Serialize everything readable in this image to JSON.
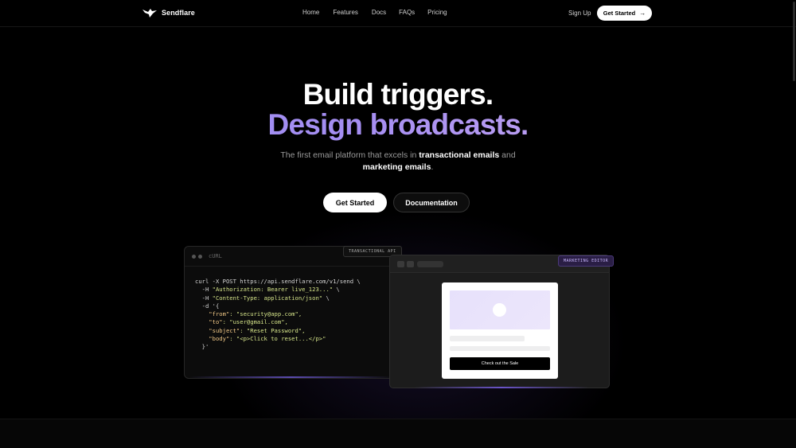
{
  "nav": {
    "brand": "Sendflare",
    "links": [
      "Home",
      "Features",
      "Docs",
      "FAQs",
      "Pricing"
    ],
    "signup": "Sign Up",
    "cta": "Get Started",
    "cta_icon": "arrow-right-icon"
  },
  "hero": {
    "line1": "Build triggers.",
    "line2": "Design broadcasts.",
    "sub_prefix": "The first email platform that excels in ",
    "sub_bold1": "transactional emails",
    "sub_mid": " and",
    "sub_bold2": "marketing emails",
    "sub_suffix": ".",
    "primary_button": "Get Started",
    "secondary_button": "Documentation",
    "gradient_colors": [
      "#9a8ff0",
      "#d6b3f2"
    ]
  },
  "code_panel": {
    "title": "cURL",
    "tag": "TRANSACTIONAL API",
    "lines": {
      "l1": "curl -X POST https://api.sendflare.com/v1/send \\",
      "l2a": "  -H ",
      "l2b": "\"Authorization: Bearer live_123...\"",
      "l2c": " \\",
      "l3a": "  -H ",
      "l3b": "\"Content-Type: application/json\"",
      "l3c": " \\",
      "l4": "  -d '{",
      "l5k": "    \"from\"",
      "l5v": ": \"security@app.com\",",
      "l6k": "    \"to\"",
      "l6v": ": \"user@gmail.com\",",
      "l7k": "    \"subject\"",
      "l7v": ": \"Reset Password\",",
      "l8k": "    \"body\"",
      "l8v": ": \"<p>Click to reset...</p>\"",
      "l9": "  }'"
    }
  },
  "editor_panel": {
    "tag": "MARKETING EDITOR",
    "card_button": "Check out the Sale"
  }
}
